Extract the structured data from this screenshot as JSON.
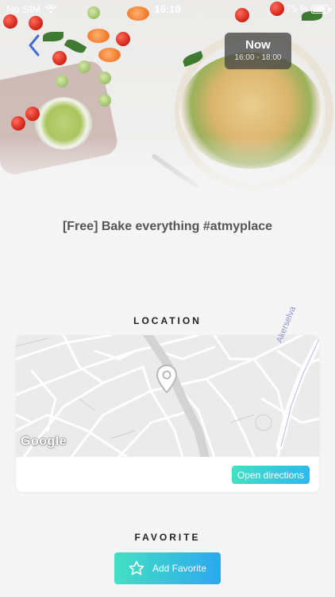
{
  "status_bar": {
    "carrier": "No SIM",
    "time": "16:10",
    "battery_text": "75 %",
    "wifi_icon": "wifi-icon"
  },
  "header": {
    "back_icon": "chevron-left-icon",
    "now_label": "Now",
    "now_time": "16:00 - 18:00"
  },
  "event": {
    "title": "[Free] Bake everything #atmyplace"
  },
  "location": {
    "heading": "LOCATION",
    "map_provider": "Google",
    "river_label": "Akerselva",
    "pin_icon": "map-pin-icon",
    "directions_label": "Open directions"
  },
  "favorite": {
    "heading": "FAVORITE",
    "button_label": "Add Favorite",
    "star_icon": "star-icon"
  },
  "colors": {
    "accent_start": "#43e0c3",
    "accent_end": "#2ca8f0",
    "back_icon": "#3f6fd1"
  }
}
